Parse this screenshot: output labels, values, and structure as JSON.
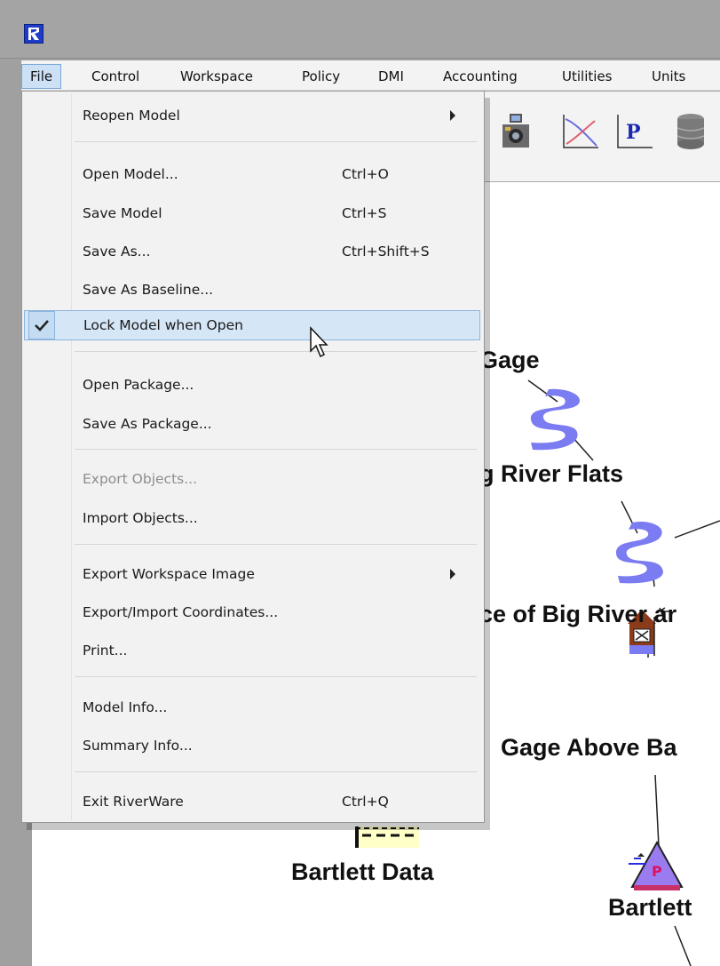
{
  "menubar": {
    "items": [
      {
        "label": "File"
      },
      {
        "label": "Control"
      },
      {
        "label": "Workspace"
      },
      {
        "label": "Policy"
      },
      {
        "label": "DMI"
      },
      {
        "label": "Accounting"
      },
      {
        "label": "Utilities"
      },
      {
        "label": "Units"
      }
    ]
  },
  "file_menu": {
    "items": [
      {
        "label": "Reopen Model",
        "shortcut": "",
        "submenu": true
      },
      {
        "label": "Open Model...",
        "shortcut": "Ctrl+O"
      },
      {
        "label": "Save Model",
        "shortcut": "Ctrl+S"
      },
      {
        "label": "Save As...",
        "shortcut": "Ctrl+Shift+S"
      },
      {
        "label": "Save As Baseline...",
        "shortcut": ""
      },
      {
        "label": "Lock Model when Open",
        "shortcut": "",
        "checked": true
      },
      {
        "label": "Open Package...",
        "shortcut": ""
      },
      {
        "label": "Save As Package...",
        "shortcut": ""
      },
      {
        "label": "Export Objects...",
        "shortcut": "",
        "disabled": true
      },
      {
        "label": "Import Objects...",
        "shortcut": ""
      },
      {
        "label": "Export Workspace Image",
        "shortcut": "",
        "submenu": true
      },
      {
        "label": "Export/Import Coordinates...",
        "shortcut": ""
      },
      {
        "label": "Print...",
        "shortcut": ""
      },
      {
        "label": "Model Info...",
        "shortcut": ""
      },
      {
        "label": "Summary Info...",
        "shortcut": ""
      },
      {
        "label": "Exit RiverWare",
        "shortcut": "Ctrl+Q"
      }
    ]
  },
  "workspace": {
    "labels": [
      "Gage",
      "g River Flats",
      "ce of Big River ar",
      "Gage Above Ba",
      "Bartlett Data",
      "Bartlett"
    ],
    "icons": [
      "reach-icon",
      "reach-icon",
      "stream-gage-icon",
      "data-object-icon",
      "reservoir-icon"
    ]
  },
  "toolbar": {
    "icons": [
      "camera-icon",
      "plot-icon",
      "parameter-icon",
      "database-icon"
    ]
  },
  "colors": {
    "menu_highlight": "#d5e6f7",
    "menubar_active": "#cce0f6",
    "reach_blue": "#7b7bf2",
    "reservoir_purple": "#9b7bf0",
    "app_icon_blue": "#1e3cc8"
  }
}
